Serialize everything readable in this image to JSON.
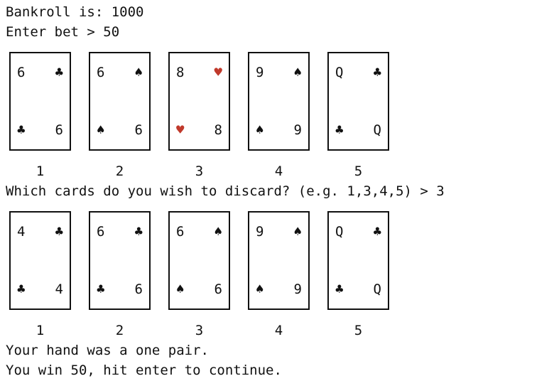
{
  "terminal": {
    "line_bankroll": "Bankroll is: 1000",
    "line_bet": "Enter bet > 50",
    "line_discard": "Which cards do you wish to discard? (e.g. 1,3,4,5) > 3",
    "line_result": "Your hand was a one pair.",
    "line_win": "You win 50, hit enter to continue."
  },
  "hand1": {
    "cards": [
      {
        "rank": "6",
        "suit": "♣",
        "color": "#111111"
      },
      {
        "rank": "6",
        "suit": "♠",
        "color": "#111111"
      },
      {
        "rank": "8",
        "suit": "♥",
        "color": "#c0392b"
      },
      {
        "rank": "9",
        "suit": "♠",
        "color": "#111111"
      },
      {
        "rank": "Q",
        "suit": "♣",
        "color": "#111111"
      }
    ],
    "indices": [
      "1",
      "2",
      "3",
      "4",
      "5"
    ]
  },
  "hand2": {
    "cards": [
      {
        "rank": "4",
        "suit": "♣",
        "color": "#111111"
      },
      {
        "rank": "6",
        "suit": "♣",
        "color": "#111111"
      },
      {
        "rank": "6",
        "suit": "♠",
        "color": "#111111"
      },
      {
        "rank": "9",
        "suit": "♠",
        "color": "#111111"
      },
      {
        "rank": "Q",
        "suit": "♣",
        "color": "#111111"
      }
    ],
    "indices": [
      "1",
      "2",
      "3",
      "4",
      "5"
    ]
  }
}
